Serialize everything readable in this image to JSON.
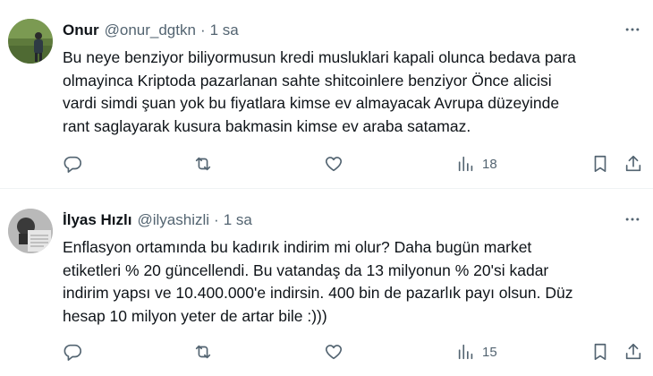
{
  "tweets": [
    {
      "name": "Onur",
      "handle": "@onur_dgtkn",
      "separator": "·",
      "time": "1 sa",
      "lines": [
        "Bu neye benziyor biliyormusun kredi musluklari kapali olunca bedava para",
        "olmayinca Kriptoda pazarlanan sahte shitcoinlere benziyor Önce alicisi",
        "vardi simdi şuan yok bu fiyatlara kimse ev almayacak Avrupa düzeyinde",
        "rant saglayarak kusura bakmasin kimse ev araba satamaz."
      ],
      "views": "18"
    },
    {
      "name": "İlyas Hızlı",
      "handle": "@ilyashizli",
      "separator": "·",
      "time": "1 sa",
      "lines": [
        "Enflasyon ortamında bu kadırık indirim mi olur? Daha bugün market",
        "etiketleri % 20 güncellendi. Bu vatandaş da 13 milyonun % 20'si kadar",
        "indirim yapsı ve 10.400.000'e indirsin. 400 bin de pazarlık payı olsun. Düz",
        "hesap 10 milyon yeter de artar bile :)))"
      ],
      "views": "15"
    }
  ],
  "icons": [
    "more-icon",
    "reply-icon",
    "retweet-icon",
    "like-icon",
    "views-icon",
    "bookmark-icon",
    "share-icon"
  ],
  "colors": {
    "text": "#0f1419",
    "secondary": "#536471",
    "divider": "#eff3f4"
  }
}
